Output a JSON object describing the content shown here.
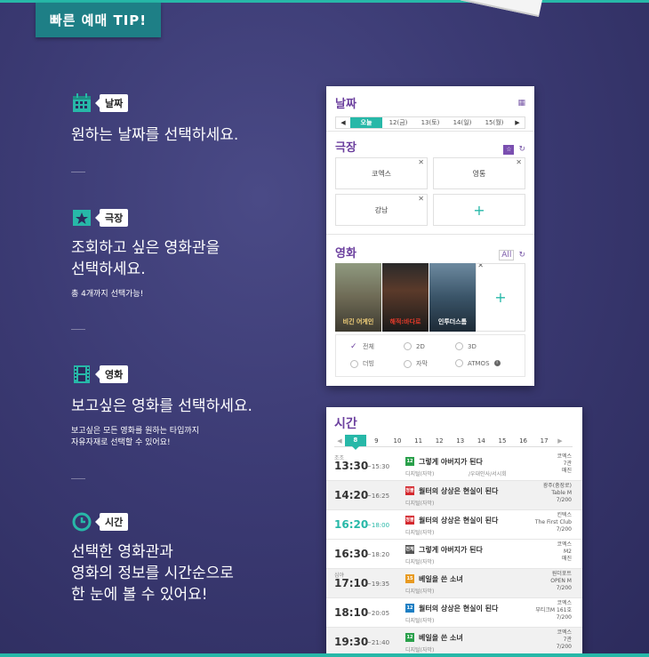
{
  "header": {
    "tip_label": "빠른 예매 TIP!"
  },
  "steps": [
    {
      "tag": "날짜",
      "title": "원하는 날짜를 선택하세요.",
      "icon": "calendar-icon"
    },
    {
      "tag": "극장",
      "title_line1": "조회하고 싶은 영화관을",
      "title_line2": "선택하세요.",
      "note": "총 4개까지 선택가능!",
      "icon": "theater-icon"
    },
    {
      "tag": "영화",
      "title": "보고싶은 영화를 선택하세요.",
      "note_line1": "보고싶은 모든 영화를 원하는 타입까지",
      "note_line2": "자유자재로 선택할 수 있어요!",
      "icon": "film-icon"
    },
    {
      "tag": "시간",
      "title_line1": "선택한 영화관과",
      "title_line2": "영화의 정보를 시간순으로",
      "title_line3": "한 눈에 볼 수 있어요!",
      "icon": "clock-icon"
    }
  ],
  "panel": {
    "date_title": "날짜",
    "dates": [
      "오늘",
      "12(금)",
      "13(토)",
      "14(일)",
      "15(월)"
    ],
    "theater_title": "극장",
    "theaters": [
      "코엑스",
      "영통",
      "강남"
    ],
    "movie_title": "영화",
    "all_label": "All",
    "posters": [
      "비긴 어게인",
      "해적:바다로",
      "인투더스톰"
    ],
    "options": [
      "전체",
      "2D",
      "3D",
      "더빙",
      "자막",
      "ATMOS"
    ]
  },
  "schedule": {
    "title": "시간",
    "days": [
      "8",
      "9",
      "10",
      "11",
      "12",
      "13",
      "14",
      "15",
      "16",
      "17"
    ],
    "rows": [
      {
        "pre": "조조",
        "start": "13:30",
        "end": "~15:30",
        "rating": "12",
        "rating_color": "#2aa04b",
        "movie": "그렇게 아버지가 된다",
        "format": "디지털(자막)",
        "extra": "/우대인사/서시회",
        "cinema1": "코엑스",
        "cinema2": "7관",
        "cinema3": "매진"
      },
      {
        "pre": "",
        "start": "14:20",
        "end": "~16:25",
        "rating": "청불",
        "rating_color": "#d4282e",
        "movie": "월터의 상상은 현실이 된다",
        "format": "디지털(자막)",
        "extra": "",
        "cinema1": "광주(충장로)",
        "cinema2": "Table M",
        "cinema3": "7/200"
      },
      {
        "pre": "",
        "start": "16:20",
        "end": "~18:00",
        "rating": "청불",
        "rating_color": "#d4282e",
        "movie": "월터의 상상은 현실이 된다",
        "format": "디지털(자막)",
        "extra": "",
        "cinema1": "킨텍스",
        "cinema2": "The First Club",
        "cinema3": "7/200"
      },
      {
        "pre": "",
        "start": "16:30",
        "end": "~18:20",
        "rating": "전체",
        "rating_color": "#555555",
        "movie": "그렇게 아버지가 된다",
        "format": "디지털(자막)",
        "extra": "",
        "cinema1": "코엑스",
        "cinema2": "M2",
        "cinema3": "매진"
      },
      {
        "pre": "심야",
        "start": "17:10",
        "end": "~19:35",
        "rating": "15",
        "rating_color": "#e89a21",
        "movie": "베일을 쓴 소녀",
        "format": "디지털(자막)",
        "extra": "",
        "cinema1": "원더포트",
        "cinema2": "OPEN M",
        "cinema3": "7/200"
      },
      {
        "pre": "",
        "start": "18:10",
        "end": "~20:05",
        "rating": "12",
        "rating_color": "#1d7fc4",
        "movie": "월터의 상상은 현실이 된다",
        "format": "디지털(자막)",
        "extra": "",
        "cinema1": "코엑스",
        "cinema2": "부티크M 161호",
        "cinema3": "7/200"
      },
      {
        "pre": "",
        "start": "19:30",
        "end": "~21:40",
        "rating": "12",
        "rating_color": "#2aa04b",
        "movie": "베일을 쓴 소녀",
        "format": "디지털(자막)",
        "extra": "",
        "cinema1": "코엑스",
        "cinema2": "7관",
        "cinema3": "7/200"
      }
    ]
  }
}
